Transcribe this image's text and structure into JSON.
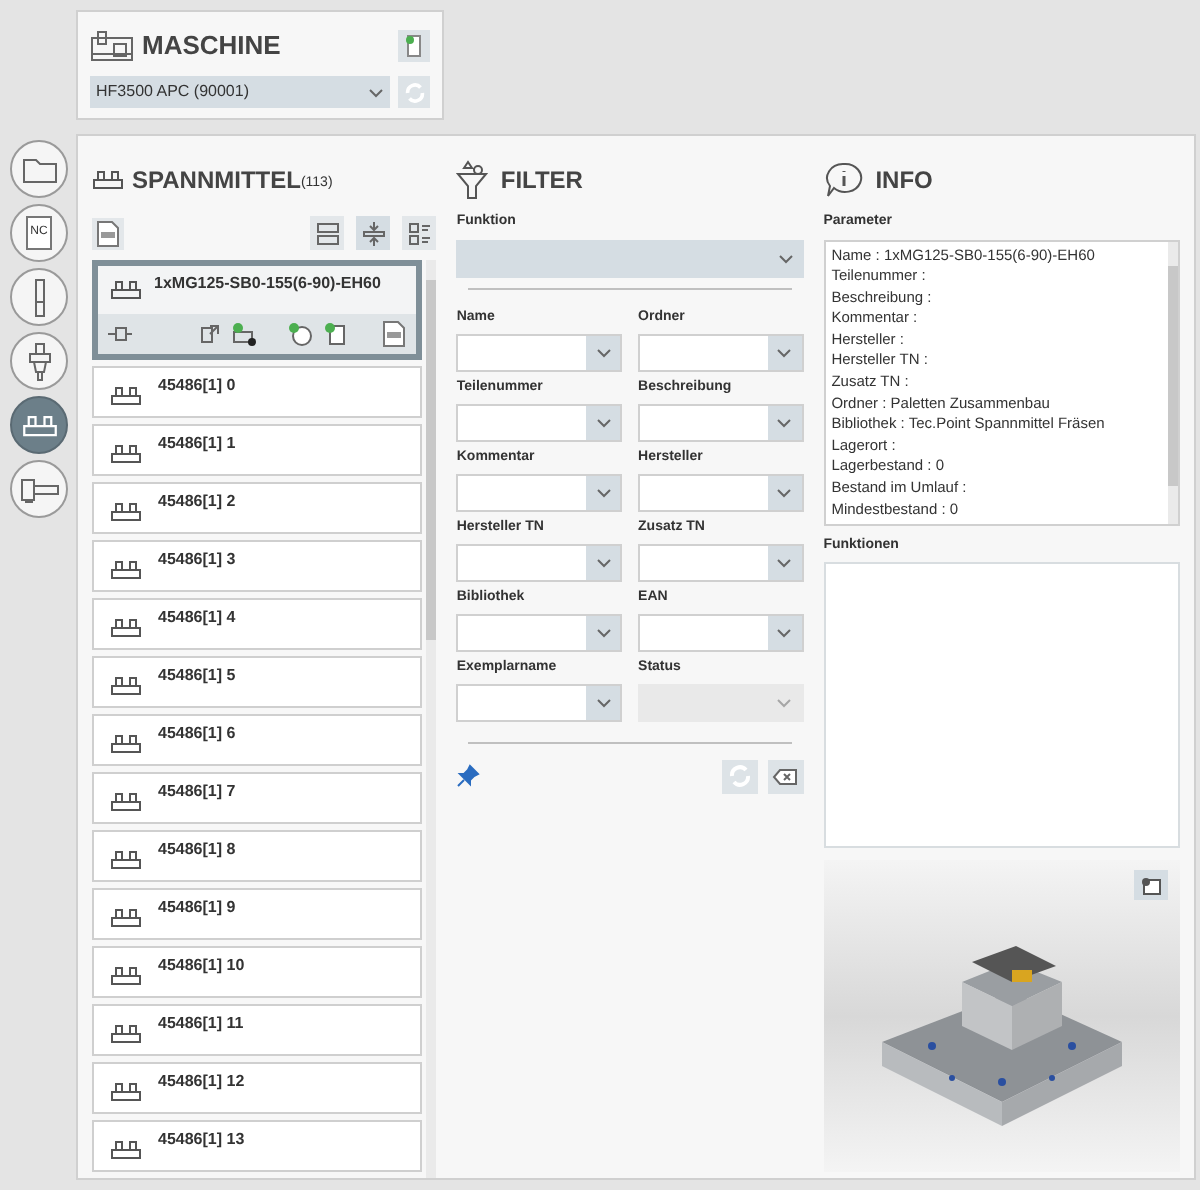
{
  "machine": {
    "title": "MASCHINE",
    "selected_machine": "HF3500 APC (90001)"
  },
  "sidebar": [
    {
      "kind": "folder",
      "selected": false
    },
    {
      "kind": "nc",
      "label": "NC",
      "selected": false
    },
    {
      "kind": "tool",
      "selected": false
    },
    {
      "kind": "holder",
      "selected": false
    },
    {
      "kind": "fixture",
      "selected": true
    },
    {
      "kind": "vise",
      "selected": false
    }
  ],
  "fixtures": {
    "title": "SPANNMITTEL",
    "count": "(113)",
    "items": [
      {
        "name": "1xMG125-SB0-155(6-90)-EH60",
        "selected": true
      },
      {
        "name": "45486[1] 0",
        "selected": false
      },
      {
        "name": "45486[1] 1",
        "selected": false
      },
      {
        "name": "45486[1] 2",
        "selected": false
      },
      {
        "name": "45486[1] 3",
        "selected": false
      },
      {
        "name": "45486[1] 4",
        "selected": false
      },
      {
        "name": "45486[1] 5",
        "selected": false
      },
      {
        "name": "45486[1] 6",
        "selected": false
      },
      {
        "name": "45486[1] 7",
        "selected": false
      },
      {
        "name": "45486[1] 8",
        "selected": false
      },
      {
        "name": "45486[1] 9",
        "selected": false
      },
      {
        "name": "45486[1] 10",
        "selected": false
      },
      {
        "name": "45486[1] 11",
        "selected": false
      },
      {
        "name": "45486[1] 12",
        "selected": false
      },
      {
        "name": "45486[1] 13",
        "selected": false
      }
    ]
  },
  "filter": {
    "title": "FILTER",
    "function_label": "Funktion",
    "fields": [
      {
        "label": "Name",
        "disabled": false
      },
      {
        "label": "Ordner",
        "disabled": false
      },
      {
        "label": "Teilenummer",
        "disabled": false
      },
      {
        "label": "Beschreibung",
        "disabled": false
      },
      {
        "label": "Kommentar",
        "disabled": false
      },
      {
        "label": "Hersteller",
        "disabled": false
      },
      {
        "label": "Hersteller TN",
        "disabled": false
      },
      {
        "label": "Zusatz TN",
        "disabled": false
      },
      {
        "label": "Bibliothek",
        "disabled": false
      },
      {
        "label": "EAN",
        "disabled": false
      },
      {
        "label": "Exemplarname",
        "disabled": false
      },
      {
        "label": "Status",
        "disabled": true
      }
    ]
  },
  "info": {
    "title": "INFO",
    "parameter_label": "Parameter",
    "parameters": [
      "Name : 1xMG125-SB0-155(6-90)-EH60",
      "Teilenummer :",
      "Beschreibung :",
      "Kommentar :",
      "Hersteller :",
      "Hersteller TN :",
      "Zusatz TN :",
      "Ordner : Paletten Zusammenbau",
      "Bibliothek : Tec.Point Spannmittel Fräsen",
      "Lagerort :",
      "Lagerbestand : 0",
      "Bestand im Umlauf :",
      "Mindestbestand : 0"
    ],
    "functions_label": "Funktionen"
  }
}
